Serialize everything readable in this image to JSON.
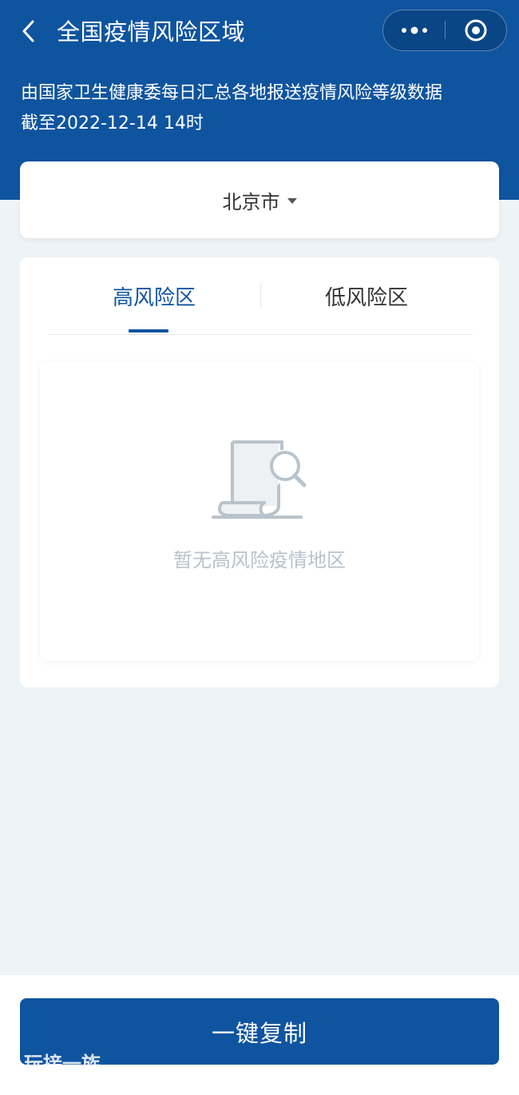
{
  "header": {
    "title": "全国疫情风险区域",
    "subtitle_line1": "由国家卫生健康委每日汇总各地报送疫情风险等级数据",
    "subtitle_line2": "截至2022-12-14 14时",
    "background": "#0f549f"
  },
  "capsule": {
    "more_icon": "more-dots-icon",
    "close_icon": "target-icon"
  },
  "region": {
    "selected": "北京市",
    "icon": "caret-down-icon"
  },
  "tabs": [
    {
      "label": "高风险区",
      "active": true
    },
    {
      "label": "低风险区",
      "active": false
    }
  ],
  "empty_state": {
    "icon": "document-search-icon",
    "text": "暂无高风险疫情地区"
  },
  "footer": {
    "copy_label": "一键复制"
  },
  "watermark": "玩接一族",
  "colors": {
    "accent": "#0f549f",
    "page_background": "#eef3f7",
    "muted_text": "#b8c2cb"
  }
}
